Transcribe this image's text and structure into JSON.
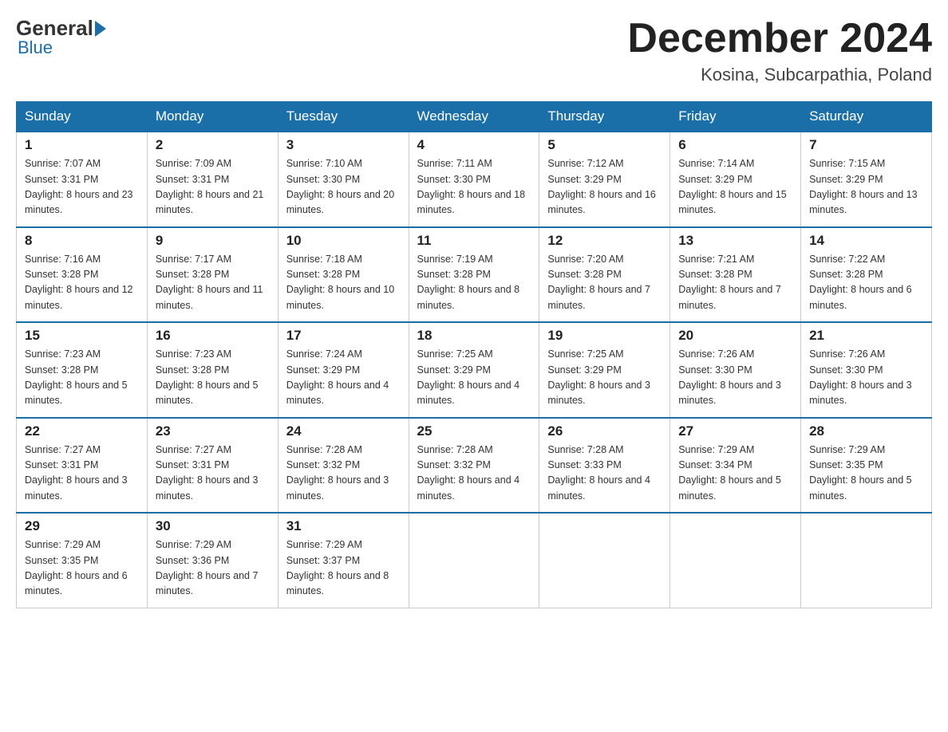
{
  "header": {
    "logo_general": "General",
    "logo_blue": "Blue",
    "month_title": "December 2024",
    "subtitle": "Kosina, Subcarpathia, Poland"
  },
  "weekdays": [
    "Sunday",
    "Monday",
    "Tuesday",
    "Wednesday",
    "Thursday",
    "Friday",
    "Saturday"
  ],
  "weeks": [
    [
      {
        "day": "1",
        "sunrise": "7:07 AM",
        "sunset": "3:31 PM",
        "daylight": "8 hours and 23 minutes."
      },
      {
        "day": "2",
        "sunrise": "7:09 AM",
        "sunset": "3:31 PM",
        "daylight": "8 hours and 21 minutes."
      },
      {
        "day": "3",
        "sunrise": "7:10 AM",
        "sunset": "3:30 PM",
        "daylight": "8 hours and 20 minutes."
      },
      {
        "day": "4",
        "sunrise": "7:11 AM",
        "sunset": "3:30 PM",
        "daylight": "8 hours and 18 minutes."
      },
      {
        "day": "5",
        "sunrise": "7:12 AM",
        "sunset": "3:29 PM",
        "daylight": "8 hours and 16 minutes."
      },
      {
        "day": "6",
        "sunrise": "7:14 AM",
        "sunset": "3:29 PM",
        "daylight": "8 hours and 15 minutes."
      },
      {
        "day": "7",
        "sunrise": "7:15 AM",
        "sunset": "3:29 PM",
        "daylight": "8 hours and 13 minutes."
      }
    ],
    [
      {
        "day": "8",
        "sunrise": "7:16 AM",
        "sunset": "3:28 PM",
        "daylight": "8 hours and 12 minutes."
      },
      {
        "day": "9",
        "sunrise": "7:17 AM",
        "sunset": "3:28 PM",
        "daylight": "8 hours and 11 minutes."
      },
      {
        "day": "10",
        "sunrise": "7:18 AM",
        "sunset": "3:28 PM",
        "daylight": "8 hours and 10 minutes."
      },
      {
        "day": "11",
        "sunrise": "7:19 AM",
        "sunset": "3:28 PM",
        "daylight": "8 hours and 8 minutes."
      },
      {
        "day": "12",
        "sunrise": "7:20 AM",
        "sunset": "3:28 PM",
        "daylight": "8 hours and 7 minutes."
      },
      {
        "day": "13",
        "sunrise": "7:21 AM",
        "sunset": "3:28 PM",
        "daylight": "8 hours and 7 minutes."
      },
      {
        "day": "14",
        "sunrise": "7:22 AM",
        "sunset": "3:28 PM",
        "daylight": "8 hours and 6 minutes."
      }
    ],
    [
      {
        "day": "15",
        "sunrise": "7:23 AM",
        "sunset": "3:28 PM",
        "daylight": "8 hours and 5 minutes."
      },
      {
        "day": "16",
        "sunrise": "7:23 AM",
        "sunset": "3:28 PM",
        "daylight": "8 hours and 5 minutes."
      },
      {
        "day": "17",
        "sunrise": "7:24 AM",
        "sunset": "3:29 PM",
        "daylight": "8 hours and 4 minutes."
      },
      {
        "day": "18",
        "sunrise": "7:25 AM",
        "sunset": "3:29 PM",
        "daylight": "8 hours and 4 minutes."
      },
      {
        "day": "19",
        "sunrise": "7:25 AM",
        "sunset": "3:29 PM",
        "daylight": "8 hours and 3 minutes."
      },
      {
        "day": "20",
        "sunrise": "7:26 AM",
        "sunset": "3:30 PM",
        "daylight": "8 hours and 3 minutes."
      },
      {
        "day": "21",
        "sunrise": "7:26 AM",
        "sunset": "3:30 PM",
        "daylight": "8 hours and 3 minutes."
      }
    ],
    [
      {
        "day": "22",
        "sunrise": "7:27 AM",
        "sunset": "3:31 PM",
        "daylight": "8 hours and 3 minutes."
      },
      {
        "day": "23",
        "sunrise": "7:27 AM",
        "sunset": "3:31 PM",
        "daylight": "8 hours and 3 minutes."
      },
      {
        "day": "24",
        "sunrise": "7:28 AM",
        "sunset": "3:32 PM",
        "daylight": "8 hours and 3 minutes."
      },
      {
        "day": "25",
        "sunrise": "7:28 AM",
        "sunset": "3:32 PM",
        "daylight": "8 hours and 4 minutes."
      },
      {
        "day": "26",
        "sunrise": "7:28 AM",
        "sunset": "3:33 PM",
        "daylight": "8 hours and 4 minutes."
      },
      {
        "day": "27",
        "sunrise": "7:29 AM",
        "sunset": "3:34 PM",
        "daylight": "8 hours and 5 minutes."
      },
      {
        "day": "28",
        "sunrise": "7:29 AM",
        "sunset": "3:35 PM",
        "daylight": "8 hours and 5 minutes."
      }
    ],
    [
      {
        "day": "29",
        "sunrise": "7:29 AM",
        "sunset": "3:35 PM",
        "daylight": "8 hours and 6 minutes."
      },
      {
        "day": "30",
        "sunrise": "7:29 AM",
        "sunset": "3:36 PM",
        "daylight": "8 hours and 7 minutes."
      },
      {
        "day": "31",
        "sunrise": "7:29 AM",
        "sunset": "3:37 PM",
        "daylight": "8 hours and 8 minutes."
      },
      null,
      null,
      null,
      null
    ]
  ]
}
